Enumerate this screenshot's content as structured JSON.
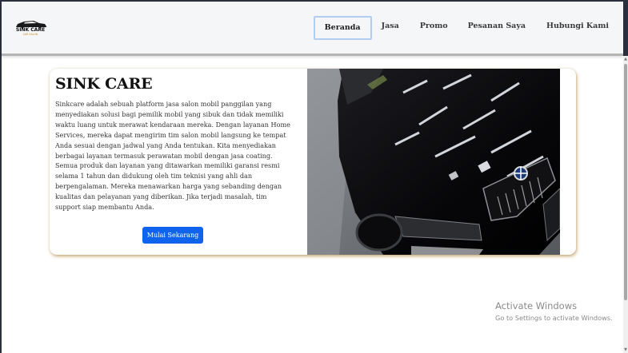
{
  "brand": {
    "name": "SINK CARE",
    "tagline": "CAR SALON"
  },
  "nav": {
    "items": [
      {
        "label": "Beranda",
        "active": true
      },
      {
        "label": "Jasa"
      },
      {
        "label": "Promo"
      },
      {
        "label": "Pesanan Saya"
      },
      {
        "label": "Hubungi Kami"
      }
    ]
  },
  "hero": {
    "title": "SINK CARE",
    "description": "Sinkcare adalah sebuah platform jasa salon mobil panggilan yang menyediakan solusi bagi pemilik mobil yang sibuk dan tidak memiliki waktu luang untuk merawat kendaraan mereka. Dengan layanan Home Services, mereka dapat mengirim tim salon mobil langsung ke tempat Anda sesuai dengan jadwal yang Anda tentukan. Kita menyediakan berbagai layanan termasuk perawatan mobil dengan jasa coating. Semua produk dan layanan yang ditawarkan memiliki garansi resmi selama 1 tahun dan didukung oleh tim teknisi yang ahli dan berpengalaman. Mereka menawarkan harga yang sebanding dengan kualitas dan pelayanan yang diberikan. Jika terjadi masalah, tim support siap membantu Anda.",
    "cta_label": "Mulai Sekarang",
    "image_icon": "car-photo"
  },
  "watermark": {
    "title": "Activate Windows",
    "subtitle": "Go to Settings to activate Windows."
  },
  "colors": {
    "accent": "#0f63ec",
    "card_shadow": "#c19e60",
    "nav_active_border": "#b3cdf0"
  }
}
